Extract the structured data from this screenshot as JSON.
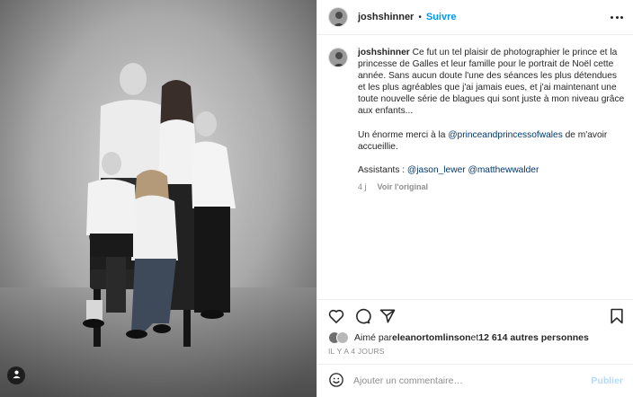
{
  "post": {
    "author": "joshshinner",
    "follow_label": "Suivre",
    "separator": "•",
    "caption": {
      "username": "joshshinner",
      "paragraph1": "Ce fut un tel plaisir de photographier le prince et la princesse de Galles et leur famille pour le portrait de Noël cette année. Sans aucun doute l'une des séances les plus détendues et les plus agréables que j'ai jamais eues, et j'ai maintenant une toute nouvelle série de blagues qui sont juste à mon niveau grâce aux enfants...",
      "divider1": "⠀⠀⠀⠀⠀⠀⠀⠀⠀",
      "thanks_prefix": "Un énorme merci à la ",
      "thanks_mention": "@princeandprincessofwales",
      "thanks_suffix": " de m'avoir accueillie.",
      "divider2": "⠀⠀⠀⠀⠀⠀⠀⠀⠀",
      "assistants_prefix": "Assistants : ",
      "assistant1": "@jason_lewer",
      "assistant2": "@matthewwalder",
      "age": "4 j",
      "see_original": "Voir l'original"
    },
    "likes": {
      "prefix": "Aimé par ",
      "user": "eleanortomlinson",
      "middle": " et ",
      "count_text": "12 614 autres personnes"
    },
    "time_ago": "IL Y A 4 JOURS",
    "comment": {
      "placeholder": "Ajouter un commentaire…",
      "publish_label": "Publier"
    }
  },
  "icons": {
    "more": "more-options-icon",
    "like": "heart-icon",
    "comment": "comment-icon",
    "share": "paper-plane-icon",
    "save": "bookmark-icon",
    "emoji": "emoji-icon",
    "tag": "tagged-user-icon"
  },
  "colors": {
    "accent": "#0095f6",
    "link": "#00376b",
    "muted": "#8e8e8e",
    "publish_disabled": "#b3dbff"
  }
}
